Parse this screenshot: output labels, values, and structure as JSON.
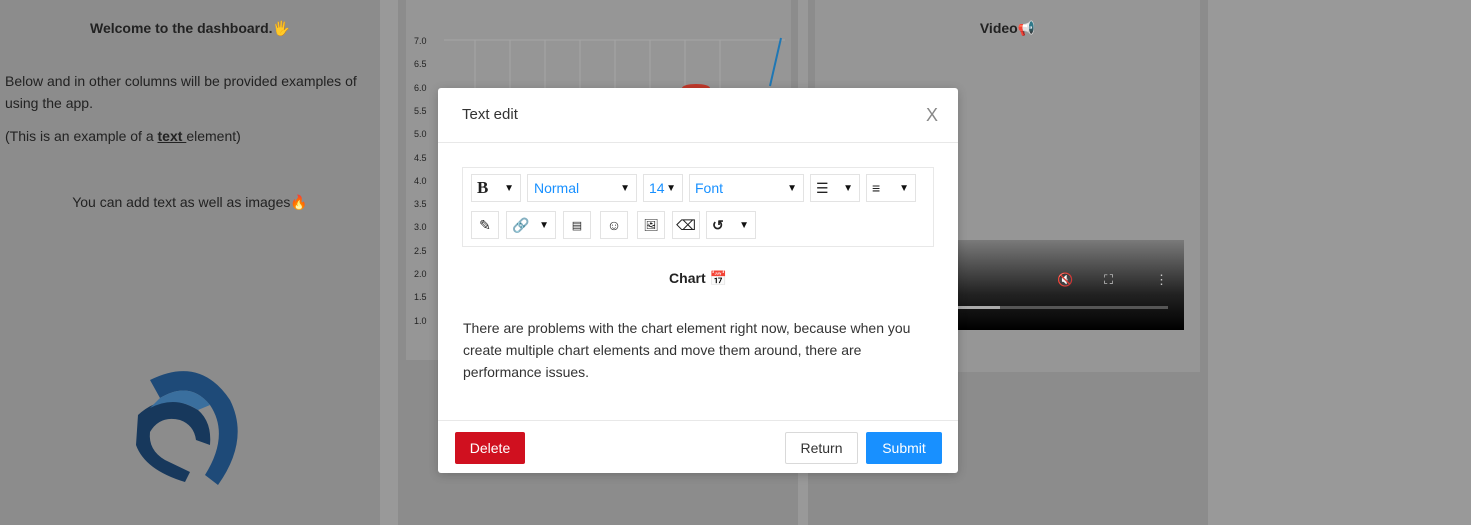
{
  "left_column": {
    "title": "Welcome to the dashboard.🖐",
    "description": "Below and in other columns will be provided examples of using the app.",
    "example_prefix": "(This is an example of a ",
    "example_bold": "text ",
    "example_suffix": "element)",
    "images_text": "You can add text as well as images🔥"
  },
  "chart_preview": {
    "y_ticks": [
      "7.0",
      "6.5",
      "6.0",
      "5.5",
      "5.0",
      "4.5",
      "4.0",
      "3.5",
      "3.0",
      "2.5",
      "2.0",
      "1.5",
      "1.0"
    ]
  },
  "video_column": {
    "title": "Video📢",
    "controls": [
      "mute-icon",
      "fullscreen-icon",
      "more-icon"
    ]
  },
  "modal": {
    "title": "Text edit",
    "close_glyph": "X",
    "toolbar": {
      "bold": "B",
      "heading_value": "Normal",
      "size_value": "14",
      "font_value": "Font"
    },
    "content_heading": "Chart 📅",
    "content_text": "There are problems with the chart element right now, because when you create multiple chart elements and move them around, there are performance issues.",
    "buttons": {
      "delete": "Delete",
      "return": "Return",
      "submit": "Submit"
    }
  },
  "colors": {
    "delete": "#d0101f",
    "submit": "#1890ff",
    "overlay": "#8c8c8c"
  }
}
